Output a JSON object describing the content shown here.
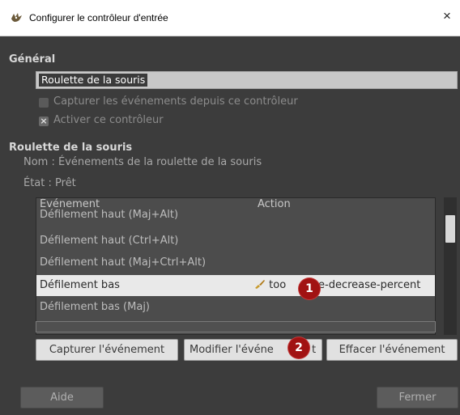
{
  "window": {
    "title": "Configurer le contrôleur d'entrée",
    "close_glyph": "×",
    "icon": "gimp-icon"
  },
  "general": {
    "heading": "Général",
    "name_value": "Roulette de la souris",
    "capture_label": "Capturer les événements depuis ce contrôleur",
    "capture_checked": false,
    "activate_label": "Activer ce contrôleur",
    "activate_checked": true
  },
  "controller": {
    "heading": "Roulette de la souris",
    "name_line": "Nom :  Événements de la roulette de la souris",
    "state_line": "État :  Prêt"
  },
  "table": {
    "col_event": "Événement",
    "col_action": "Action",
    "rows": [
      {
        "event": "Défilement haut (Maj+Alt)",
        "action": ""
      },
      {
        "event": "Défilement haut (Ctrl+Alt)",
        "action": ""
      },
      {
        "event": "Défilement haut (Maj+Ctrl+Alt)",
        "action": ""
      },
      {
        "event": "Défilement bas",
        "action": "tools-size-decrease-percent",
        "action_visible": "too",
        "action_visible_tail": "e-decrease-percent",
        "action_icon": "paintbrush-icon",
        "selected": true
      },
      {
        "event": "Défilement bas (Maj)",
        "action": ""
      }
    ]
  },
  "buttons": {
    "capture": "Capturer l'événement",
    "modify": "Modifier l'événement",
    "modify_visible_head": "Modifier l'événe",
    "modify_visible_tail": "t",
    "clear": "Effacer l'événement",
    "help": "Aide",
    "close": "Fermer"
  },
  "annotations": {
    "badge1": "1",
    "badge2": "2"
  },
  "colors": {
    "dialog_bg": "#3c3c3c",
    "selected_row_bg": "#e9e9e9",
    "badge_red": "#a11212"
  }
}
